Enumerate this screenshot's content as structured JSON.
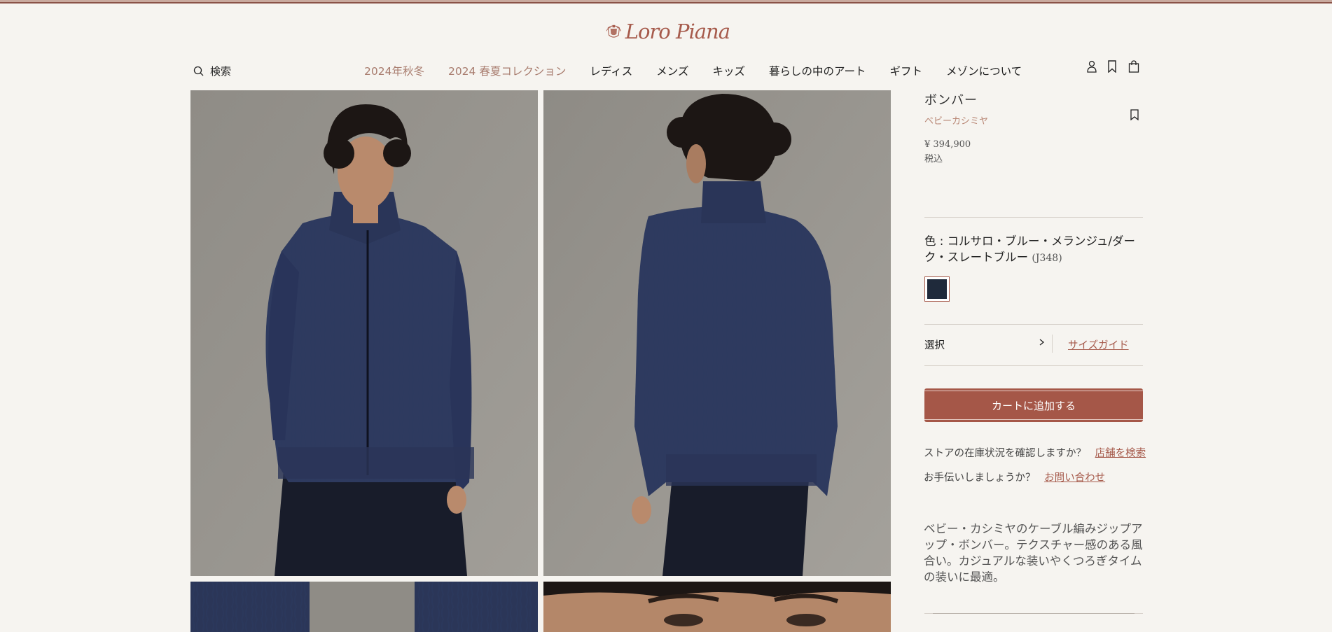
{
  "brand": {
    "name": "Loro Piana"
  },
  "search": {
    "label": "検索"
  },
  "nav": {
    "items": [
      {
        "label": "2024年秋冬"
      },
      {
        "label": "2024 春夏コレクション"
      },
      {
        "label": "レディス"
      },
      {
        "label": "メンズ"
      },
      {
        "label": "キッズ"
      },
      {
        "label": "暮らしの中のアート"
      },
      {
        "label": "ギフト"
      },
      {
        "label": "メゾンについて"
      }
    ]
  },
  "header_icons": [
    "account-icon",
    "wishlist-icon",
    "bag-icon"
  ],
  "product": {
    "name": "ボンバー",
    "material": "ベビーカシミヤ",
    "price": "¥ 394,900",
    "tax_note": "税込",
    "color_label": "色 : コルサロ・ブルー・メランジュ/ダーク・スレートブルー",
    "color_code": "(J348)",
    "swatch_color": "#1f2a3b",
    "size_select": "選択",
    "size_guide": "サイズガイド",
    "add_to_cart": "カートに追加する",
    "store_question": "ストアの在庫状況を確認しますか？",
    "store_link": "店舗を検索",
    "help_question": "お手伝いしましょうか？",
    "help_link": "お問い合わせ",
    "description": "ベビー・カシミヤのケーブル編みジップアップ・ボンバー。テクスチャー感のある風合い。カジュアルな装いやくつろぎタイムの装いに最適。"
  },
  "colors": {
    "accent": "#a55748",
    "accent_text": "#a65a4b",
    "background": "#f6f4f0"
  }
}
